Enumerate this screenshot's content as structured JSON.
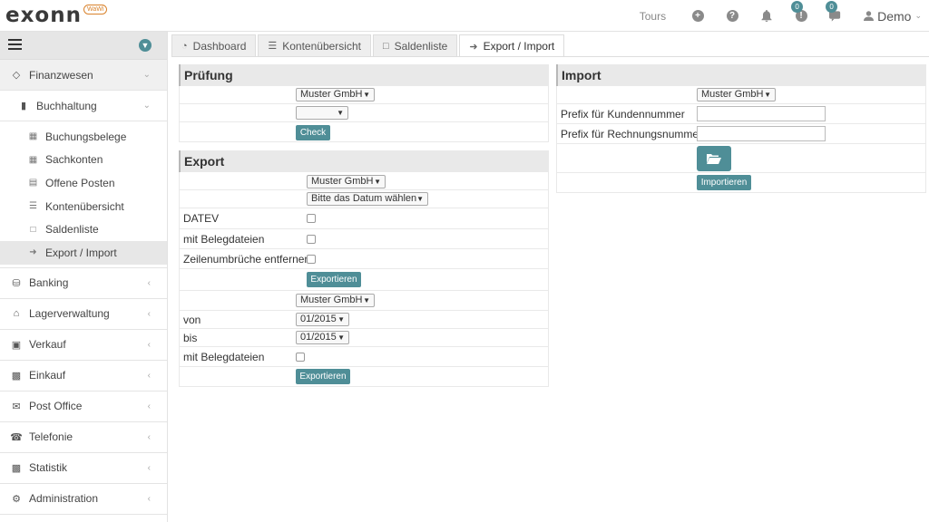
{
  "header": {
    "logo": "exonn",
    "logo_badge": "WaWi",
    "tours": "Tours",
    "badge_1": "0",
    "badge_2": "0",
    "user": "Demo"
  },
  "sidebar": {
    "finanzwesen": "Finanzwesen",
    "buchhaltung": "Buchhaltung",
    "leafs": [
      "Buchungsbelege",
      "Sachkonten",
      "Offene Posten",
      "Kontenübersicht",
      "Saldenliste",
      "Export / Import"
    ],
    "items": [
      "Banking",
      "Lagerverwaltung",
      "Verkauf",
      "Einkauf",
      "Post Office",
      "Telefonie",
      "Statistik",
      "Administration"
    ]
  },
  "tabs": [
    "Dashboard",
    "Kontenübersicht",
    "Saldenliste",
    "Export / Import"
  ],
  "pruefung": {
    "title": "Prüfung",
    "company": "Muster GmbH",
    "second_select": "",
    "check": "Check"
  },
  "export": {
    "title": "Export",
    "company": "Muster GmbH",
    "date_select": "Bitte das Datum wählen",
    "datev": "DATEV",
    "mit_belegdateien": "mit Belegdateien",
    "zeilenumbrueche": "Zeilenumbrüche entfernen",
    "export_btn": "Exportieren",
    "company2": "Muster GmbH",
    "von": "von",
    "von_value": "01/2015",
    "bis": "bis",
    "bis_value": "01/2015",
    "mit_belegdateien2": "mit Belegdateien",
    "export_btn2": "Exportieren"
  },
  "import": {
    "title": "Import",
    "company": "Muster GmbH",
    "prefix_kunden": "Prefix für Kundennummer",
    "prefix_rechnung": "Prefix für Rechnungsnummer",
    "import_btn": "Importieren"
  }
}
